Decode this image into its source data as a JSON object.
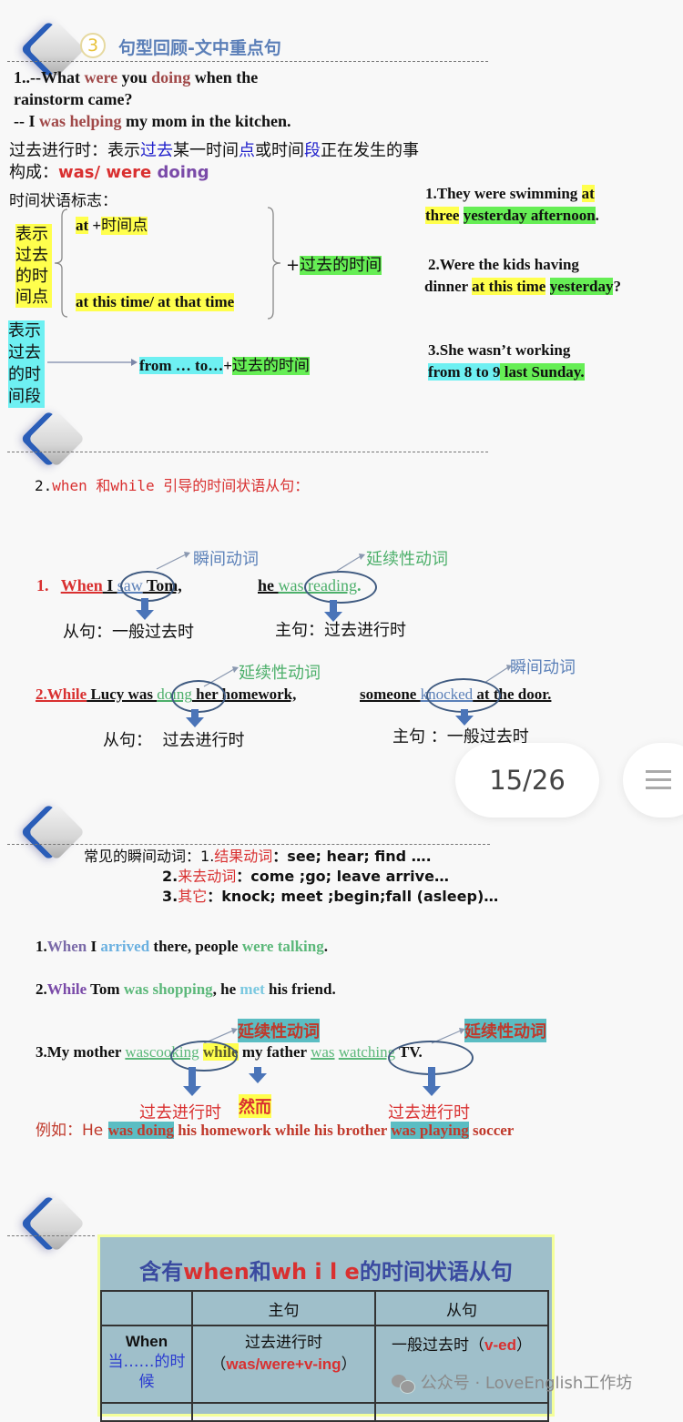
{
  "section1": {
    "number": "3",
    "heading": "句型回顾-文中重点句",
    "q_line1_parts": [
      "1..--What ",
      "were",
      " you ",
      "doing",
      " when the"
    ],
    "q_line2": "rainstorm came?",
    "a_line_parts": [
      "-- I ",
      "was helping",
      " my mom in the kitchen."
    ],
    "definition_parts": [
      "过去进行时：表示",
      "过去",
      "某一时间",
      "点",
      "或时间",
      "段",
      "正在发生的事"
    ],
    "structure_label": "构成：",
    "structure_parts": [
      "was/ were ",
      "doing"
    ],
    "markers_label": "时间状语标志：",
    "point_label": "表示过去的时间点",
    "point_label_lines": [
      "表示",
      "过去",
      "的时",
      "间点"
    ],
    "at_point": [
      "at",
      " +",
      "时间点"
    ],
    "at_this_time": "at this time/ at that time",
    "plus_past": [
      "+",
      "过去的时间"
    ],
    "period_label_lines": [
      "表示",
      "过去",
      "的时",
      "间段"
    ],
    "from_to": [
      "from … to…",
      "+",
      "过去的时间"
    ],
    "examples": [
      {
        "parts": [
          "1.They were swimming ",
          "at",
          "three",
          " ",
          "yesterday afternoon",
          "."
        ]
      },
      {
        "parts": [
          "2.Were the kids having",
          "dinner ",
          "at this time",
          " ",
          "yesterday",
          "?"
        ]
      },
      {
        "parts": [
          "3.She wasn’t working",
          "from 8 to 9",
          " ",
          "last Sunday."
        ]
      }
    ]
  },
  "section2": {
    "heading_parts": [
      "2.",
      "when 和while 引导的时间状语从句："
    ],
    "ex1": {
      "num": "1.",
      "when": "When",
      "i": " I ",
      "verb": "saw",
      "tom": " Tom,",
      "main_he": "he ",
      "main_was": "was ",
      "main_verb": "reading",
      "period": ".",
      "label_instant": "瞬间动词",
      "label_continuous": "延续性动词",
      "sub_tense": "从句：一般过去时",
      "main_tense": "主句：过去进行时"
    },
    "ex2": {
      "while": "2.While",
      "lucy": " Lucy was ",
      "verb": "doing",
      "rest": " her homework,",
      "someone": "someone ",
      "verb2": "knocked",
      "door": " at the door.",
      "label_continuous": "延续性动词",
      "label_instant": "瞬间动词",
      "sub_tense": "从句：  过去进行时",
      "main_tense": "主句 ：一般过去时"
    }
  },
  "pager": {
    "current": "15/26",
    "menu_icon": "menu-icon"
  },
  "section3": {
    "common_label": "常见的瞬间动词：",
    "lines": [
      {
        "num": "1.",
        "cat": "结果动词",
        "words": "：see;  hear;  find …."
      },
      {
        "num": "2.",
        "cat": "来去动词",
        "words": "：come ;go; leave arrive…"
      },
      {
        "num": "3.",
        "cat": "其它",
        "words": "：knock; meet ;begin;fall (asleep)…"
      }
    ],
    "s1": [
      "1.",
      "When",
      " I ",
      "arrived",
      " there, people ",
      "were talking",
      "."
    ],
    "s2": [
      "2.",
      "While",
      " Tom ",
      "was shopping",
      ", he ",
      "met",
      " his friend."
    ],
    "s3": {
      "start": "3.My mother ",
      "was1": "was",
      "cooking": "cooking",
      "while": "while",
      "mid": " my father ",
      "was2": "was",
      "watching": "watching",
      "end": " TV.",
      "label1": "延续性动词",
      "label2": "延续性动词",
      "tense1": "过去进行时",
      "however": "然而",
      "tense2": "过去进行时"
    },
    "example": [
      "例如：He ",
      "was doing",
      " his homework while his brother ",
      "was playing",
      " soccer"
    ]
  },
  "section4": {
    "table_title_parts": [
      "含有",
      "when",
      "和",
      "wh i l e",
      "的时间状语从句"
    ],
    "headers": [
      "",
      "主句",
      "从句"
    ],
    "rows": [
      {
        "key": "When",
        "key_cn": "当……的时候",
        "main": "过去进行时",
        "main_form": "was/were+v-ing",
        "sub": "一般过去时",
        "sub_form": "v-ed"
      }
    ],
    "watermark": "公众号 · LoveEnglish工作坊"
  },
  "colors": {
    "heading_blue": "#5b7fb8",
    "verb_brown": "#a04848",
    "red": "#d93030",
    "purple": "#7a4aa8",
    "blue_text": "#2222cc",
    "green_text": "#4caf6a",
    "cyan_text": "#4aa8d8",
    "yellow_hl": "#ffff4d",
    "green_hl": "#66ee55",
    "cyan_hl": "#6ef0f2",
    "teal_hl": "#5bbdc3",
    "table_bg": "#9fbfca",
    "table_border": "#f4ff9a"
  }
}
